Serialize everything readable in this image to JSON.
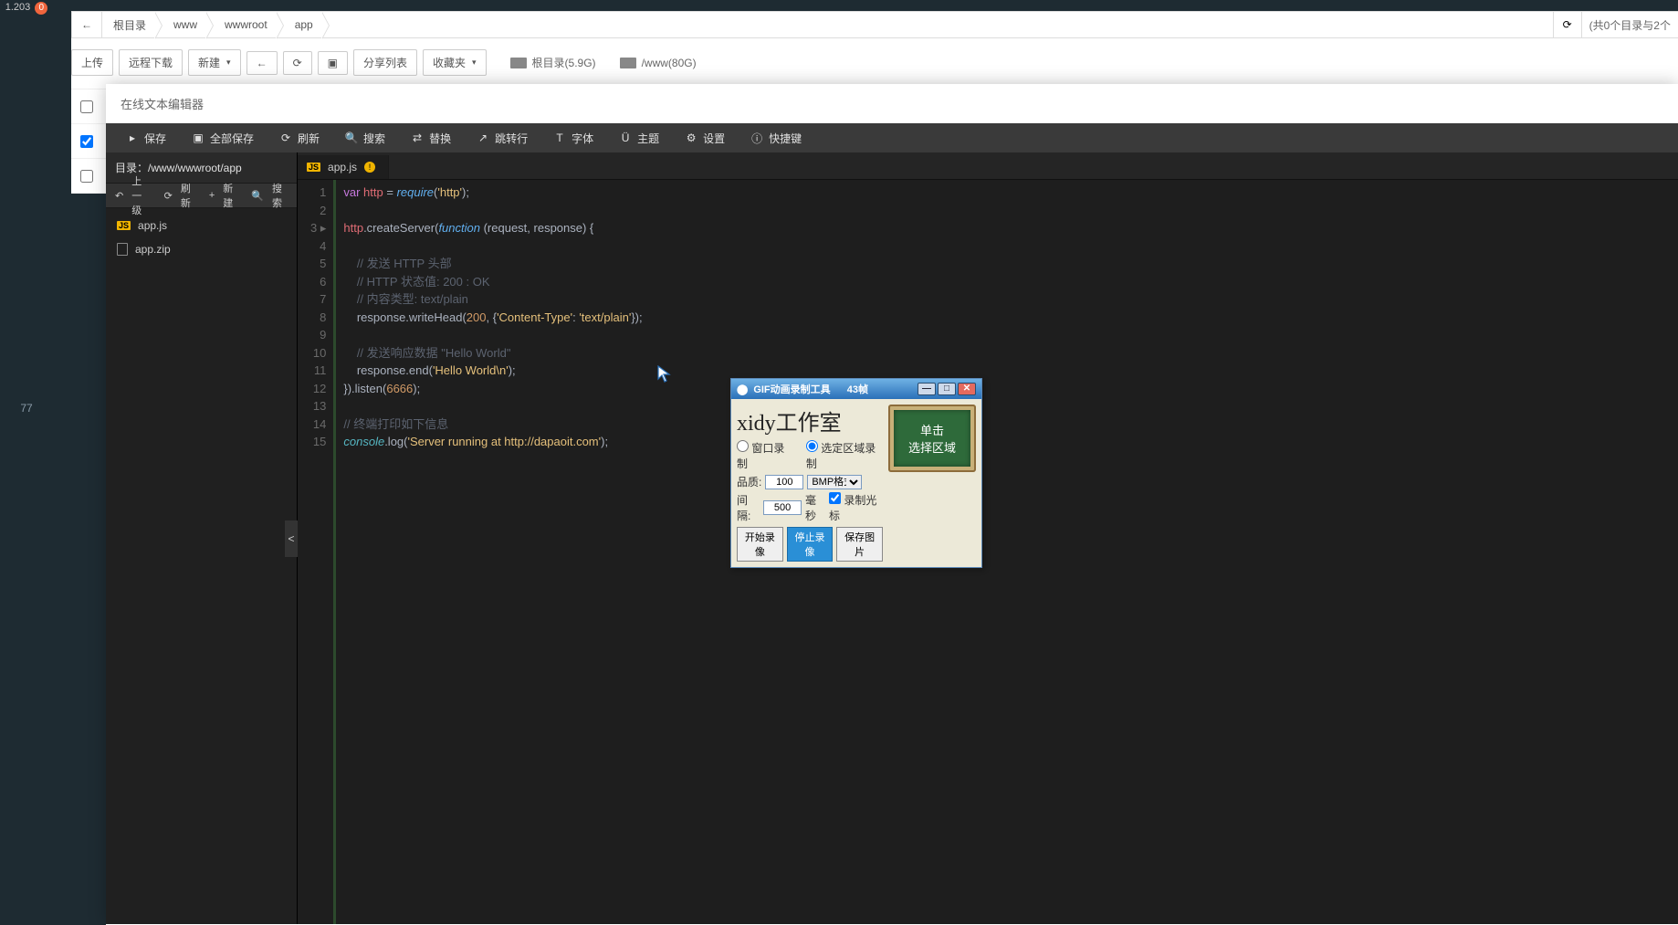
{
  "sidebar": {
    "ip": "1.203",
    "badge": "0",
    "num": "77"
  },
  "breadcrumb": {
    "back": "←",
    "segs": [
      "根目录",
      "www",
      "wwwroot",
      "app"
    ],
    "count": "(共0个目录与2个"
  },
  "toolbar": {
    "upload": "上传",
    "remote": "远程下载",
    "newfile": "新建",
    "back": "←",
    "refresh": "⟳",
    "paste": "▣",
    "sharelist": "分享列表",
    "favorites": "收藏夹",
    "disk1": "根目录(5.9G)",
    "disk2": "/www(80G)"
  },
  "editor": {
    "title": "在线文本编辑器",
    "menu": {
      "save": "保存",
      "saveall": "全部保存",
      "refresh": "刷新",
      "search": "搜索",
      "replace": "替换",
      "goto": "跳转行",
      "font": "字体",
      "theme": "主题",
      "settings": "设置",
      "shortcut": "快捷键"
    },
    "pathLabel": "目录：/www/wwwroot/app",
    "actions": {
      "up": "上一级",
      "refresh": "刷新",
      "newfile": "新建",
      "search": "搜索"
    },
    "files": [
      {
        "name": "app.js",
        "type": "js"
      },
      {
        "name": "app.zip",
        "type": "zip"
      }
    ],
    "tab": {
      "name": "app.js"
    },
    "collapse": "<",
    "code": {
      "lines": [
        {
          "n": "1",
          "frag": [
            {
              "c": "kw-var",
              "t": "var "
            },
            {
              "c": "kw-id",
              "t": "http"
            },
            {
              "c": "kw-plain",
              "t": " = "
            },
            {
              "c": "kw-fn",
              "t": "require"
            },
            {
              "c": "kw-plain",
              "t": "("
            },
            {
              "c": "kw-str",
              "t": "'http'"
            },
            {
              "c": "kw-plain",
              "t": ");"
            }
          ]
        },
        {
          "n": "2",
          "frag": [
            {
              "c": "",
              "t": ""
            }
          ]
        },
        {
          "n": "3 ▸",
          "frag": [
            {
              "c": "kw-id",
              "t": "http"
            },
            {
              "c": "kw-plain",
              "t": ".createServer("
            },
            {
              "c": "kw-fn",
              "t": "function"
            },
            {
              "c": "kw-plain",
              "t": " (request, response) {"
            }
          ]
        },
        {
          "n": "4",
          "frag": [
            {
              "c": "",
              "t": ""
            }
          ]
        },
        {
          "n": "5",
          "frag": [
            {
              "c": "kw-cmt",
              "t": "    // 发送 HTTP 头部"
            }
          ]
        },
        {
          "n": "6",
          "frag": [
            {
              "c": "kw-cmt",
              "t": "    // HTTP 状态值: 200 : OK"
            }
          ]
        },
        {
          "n": "7",
          "frag": [
            {
              "c": "kw-cmt",
              "t": "    // 内容类型: text/plain"
            }
          ]
        },
        {
          "n": "8",
          "frag": [
            {
              "c": "kw-plain",
              "t": "    response.writeHead("
            },
            {
              "c": "kw-num",
              "t": "200"
            },
            {
              "c": "kw-plain",
              "t": ", {"
            },
            {
              "c": "kw-str",
              "t": "'Content-Type'"
            },
            {
              "c": "kw-plain",
              "t": ": "
            },
            {
              "c": "kw-str",
              "t": "'text/plain'"
            },
            {
              "c": "kw-plain",
              "t": "});"
            }
          ]
        },
        {
          "n": "9",
          "frag": [
            {
              "c": "",
              "t": ""
            }
          ]
        },
        {
          "n": "10",
          "frag": [
            {
              "c": "kw-cmt",
              "t": "    // 发送响应数据 \"Hello World\""
            }
          ]
        },
        {
          "n": "11",
          "frag": [
            {
              "c": "kw-plain",
              "t": "    response.end("
            },
            {
              "c": "kw-str",
              "t": "'Hello World\\n'"
            },
            {
              "c": "kw-plain",
              "t": ");"
            }
          ]
        },
        {
          "n": "12",
          "frag": [
            {
              "c": "kw-plain",
              "t": "}).listen("
            },
            {
              "c": "kw-num",
              "t": "6666"
            },
            {
              "c": "kw-plain",
              "t": ");"
            }
          ]
        },
        {
          "n": "13",
          "frag": [
            {
              "c": "",
              "t": ""
            }
          ]
        },
        {
          "n": "14",
          "frag": [
            {
              "c": "kw-cmt",
              "t": "// 终端打印如下信息"
            }
          ]
        },
        {
          "n": "15",
          "frag": [
            {
              "c": "kw-this",
              "t": "console"
            },
            {
              "c": "kw-plain",
              "t": ".log("
            },
            {
              "c": "kw-str",
              "t": "'Server running at http://dapaoit.com'"
            },
            {
              "c": "kw-plain",
              "t": ");"
            }
          ]
        }
      ]
    }
  },
  "gif": {
    "title": "GIF动画录制工具",
    "frames": "43帧",
    "logo": "xidy工作室",
    "radio1": "窗口录制",
    "radio2": "选定区域录制",
    "qualityLabel": "品质:",
    "quality": "100",
    "format": "BMP格式",
    "intervalLabel": "间隔:",
    "interval": "500",
    "intervalUnit": "毫秒",
    "recordCursor": "录制光标",
    "btnStart": "开始录像",
    "btnStop": "停止录像",
    "btnSave": "保存图片",
    "board1": "单击",
    "board2": "选择区域"
  }
}
